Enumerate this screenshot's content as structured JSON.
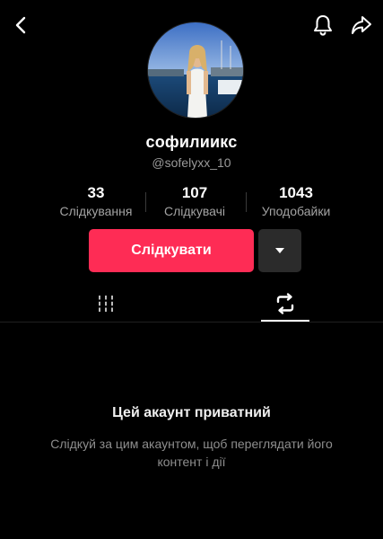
{
  "header": {
    "back_icon": "chevron-left-icon",
    "bell_icon": "bell-icon",
    "share_icon": "share-arrow-icon"
  },
  "profile": {
    "display_name": "софилиикс",
    "handle": "@sofelyxx_10",
    "avatar_icon": "avatar"
  },
  "stats": [
    {
      "value": "33",
      "label": "Слідкування"
    },
    {
      "value": "107",
      "label": "Слідкувачі"
    },
    {
      "value": "1043",
      "label": "Уподобайки"
    }
  ],
  "actions": {
    "follow_label": "Слідкувати",
    "dropdown_icon": "caret-down-icon",
    "follow_color": "#fe2c55"
  },
  "tabs": [
    {
      "icon": "grid-icon",
      "active": false
    },
    {
      "icon": "repost-icon",
      "active": true
    }
  ],
  "private_notice": {
    "title": "Цей акаунт приватний",
    "description": "Слідкуй за цим акаунтом, щоб переглядати його контент і дії"
  }
}
